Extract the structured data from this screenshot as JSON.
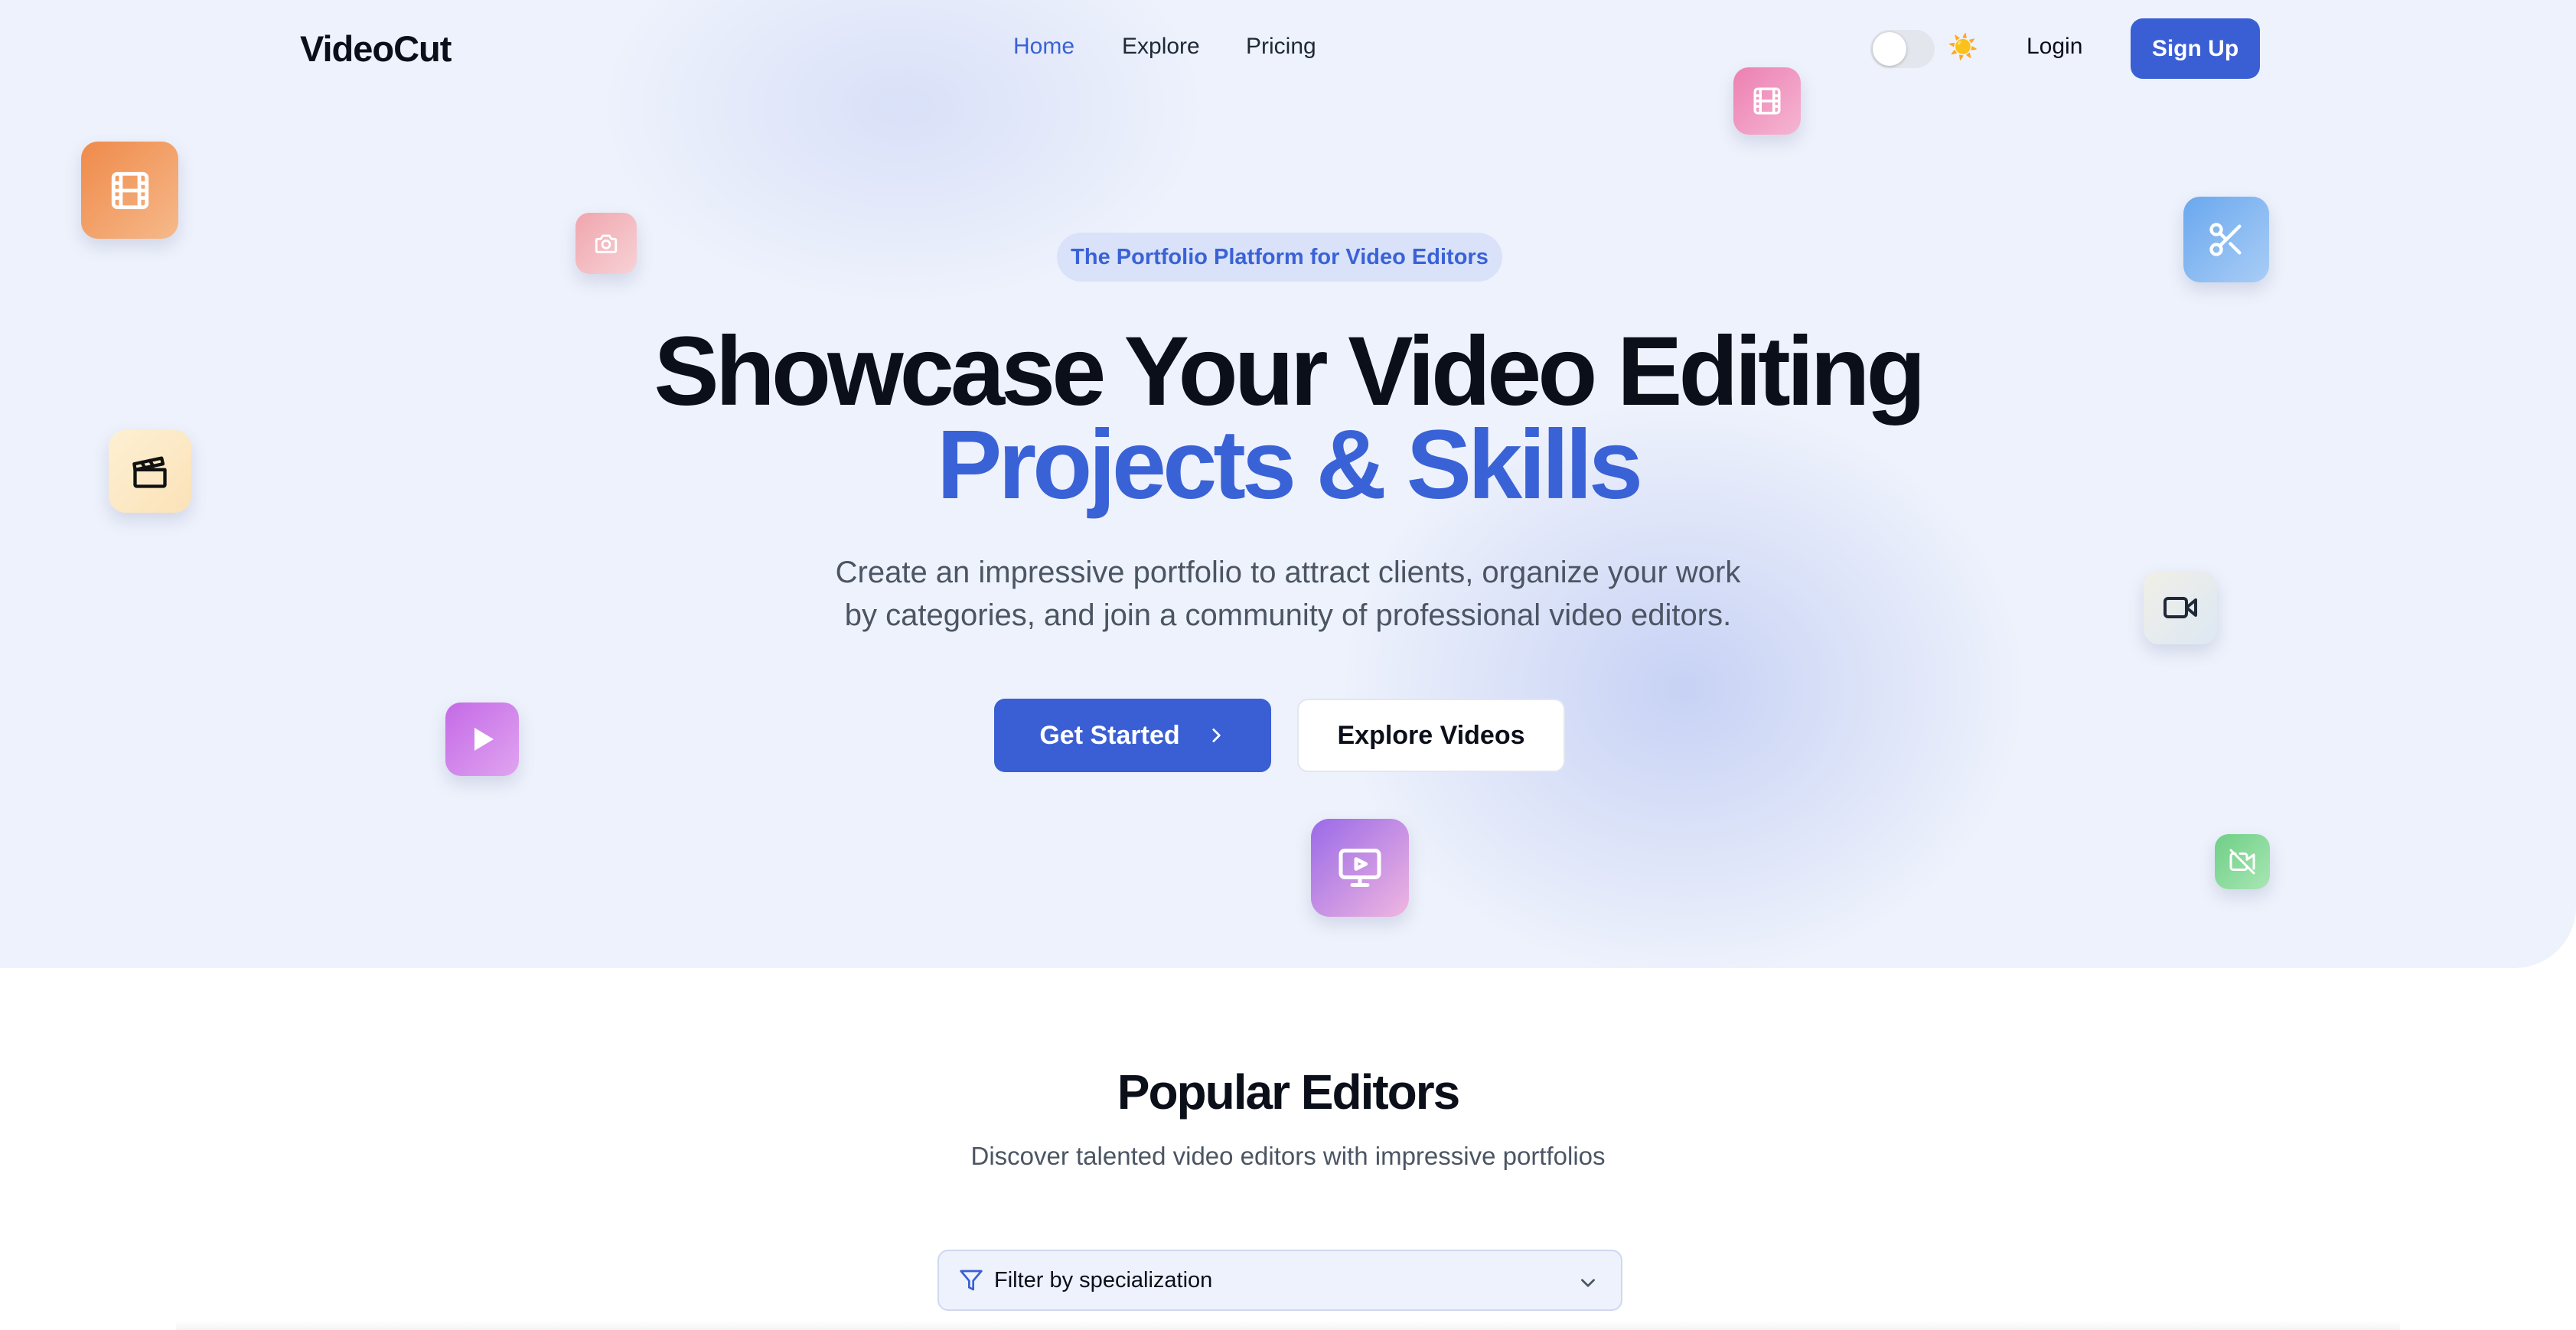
{
  "app": {
    "name": "VideoCut"
  },
  "nav": {
    "links": [
      {
        "label": "Home",
        "active": true
      },
      {
        "label": "Explore",
        "active": false
      },
      {
        "label": "Pricing",
        "active": false
      }
    ],
    "theme_toggle": {
      "state": "light",
      "icon": "sun-icon"
    },
    "login_label": "Login",
    "signup_label": "Sign Up"
  },
  "hero": {
    "badge": "The Portfolio Platform for Video Editors",
    "headline_line1": "Showcase Your Video Editing",
    "headline_line2": "Projects & Skills",
    "subtitle_line1": "Create an impressive portfolio to attract clients, organize your work",
    "subtitle_line2": "by categories, and join a community of professional video editors.",
    "primary_cta": "Get Started",
    "secondary_cta": "Explore Videos"
  },
  "floating_icons": [
    {
      "icon": "film-icon",
      "color": "#ef8a4a"
    },
    {
      "icon": "camera-icon",
      "color": "#f0a5ad"
    },
    {
      "icon": "film-icon",
      "color": "#ec7fb2"
    },
    {
      "icon": "scissors-icon",
      "color": "#6aa8ee"
    },
    {
      "icon": "clapperboard-icon",
      "color": "#fdeccb"
    },
    {
      "icon": "video-camera-icon",
      "color": "#e6eef2"
    },
    {
      "icon": "play-icon",
      "color": "#c46ae6"
    },
    {
      "icon": "monitor-play-icon",
      "color": "#9a6ae8"
    },
    {
      "icon": "video-off-icon",
      "color": "#6fcf86"
    }
  ],
  "popular_editors": {
    "title": "Popular Editors",
    "subtitle": "Discover talented video editors with impressive portfolios",
    "filter": {
      "placeholder": "Filter by specialization",
      "icon": "filter-icon"
    }
  },
  "colors": {
    "accent": "#3a5fd4",
    "accent_text": "#3a62d7",
    "hero_bg": "#eef2fc",
    "heading": "#0b0f19",
    "muted": "#4b5563"
  }
}
